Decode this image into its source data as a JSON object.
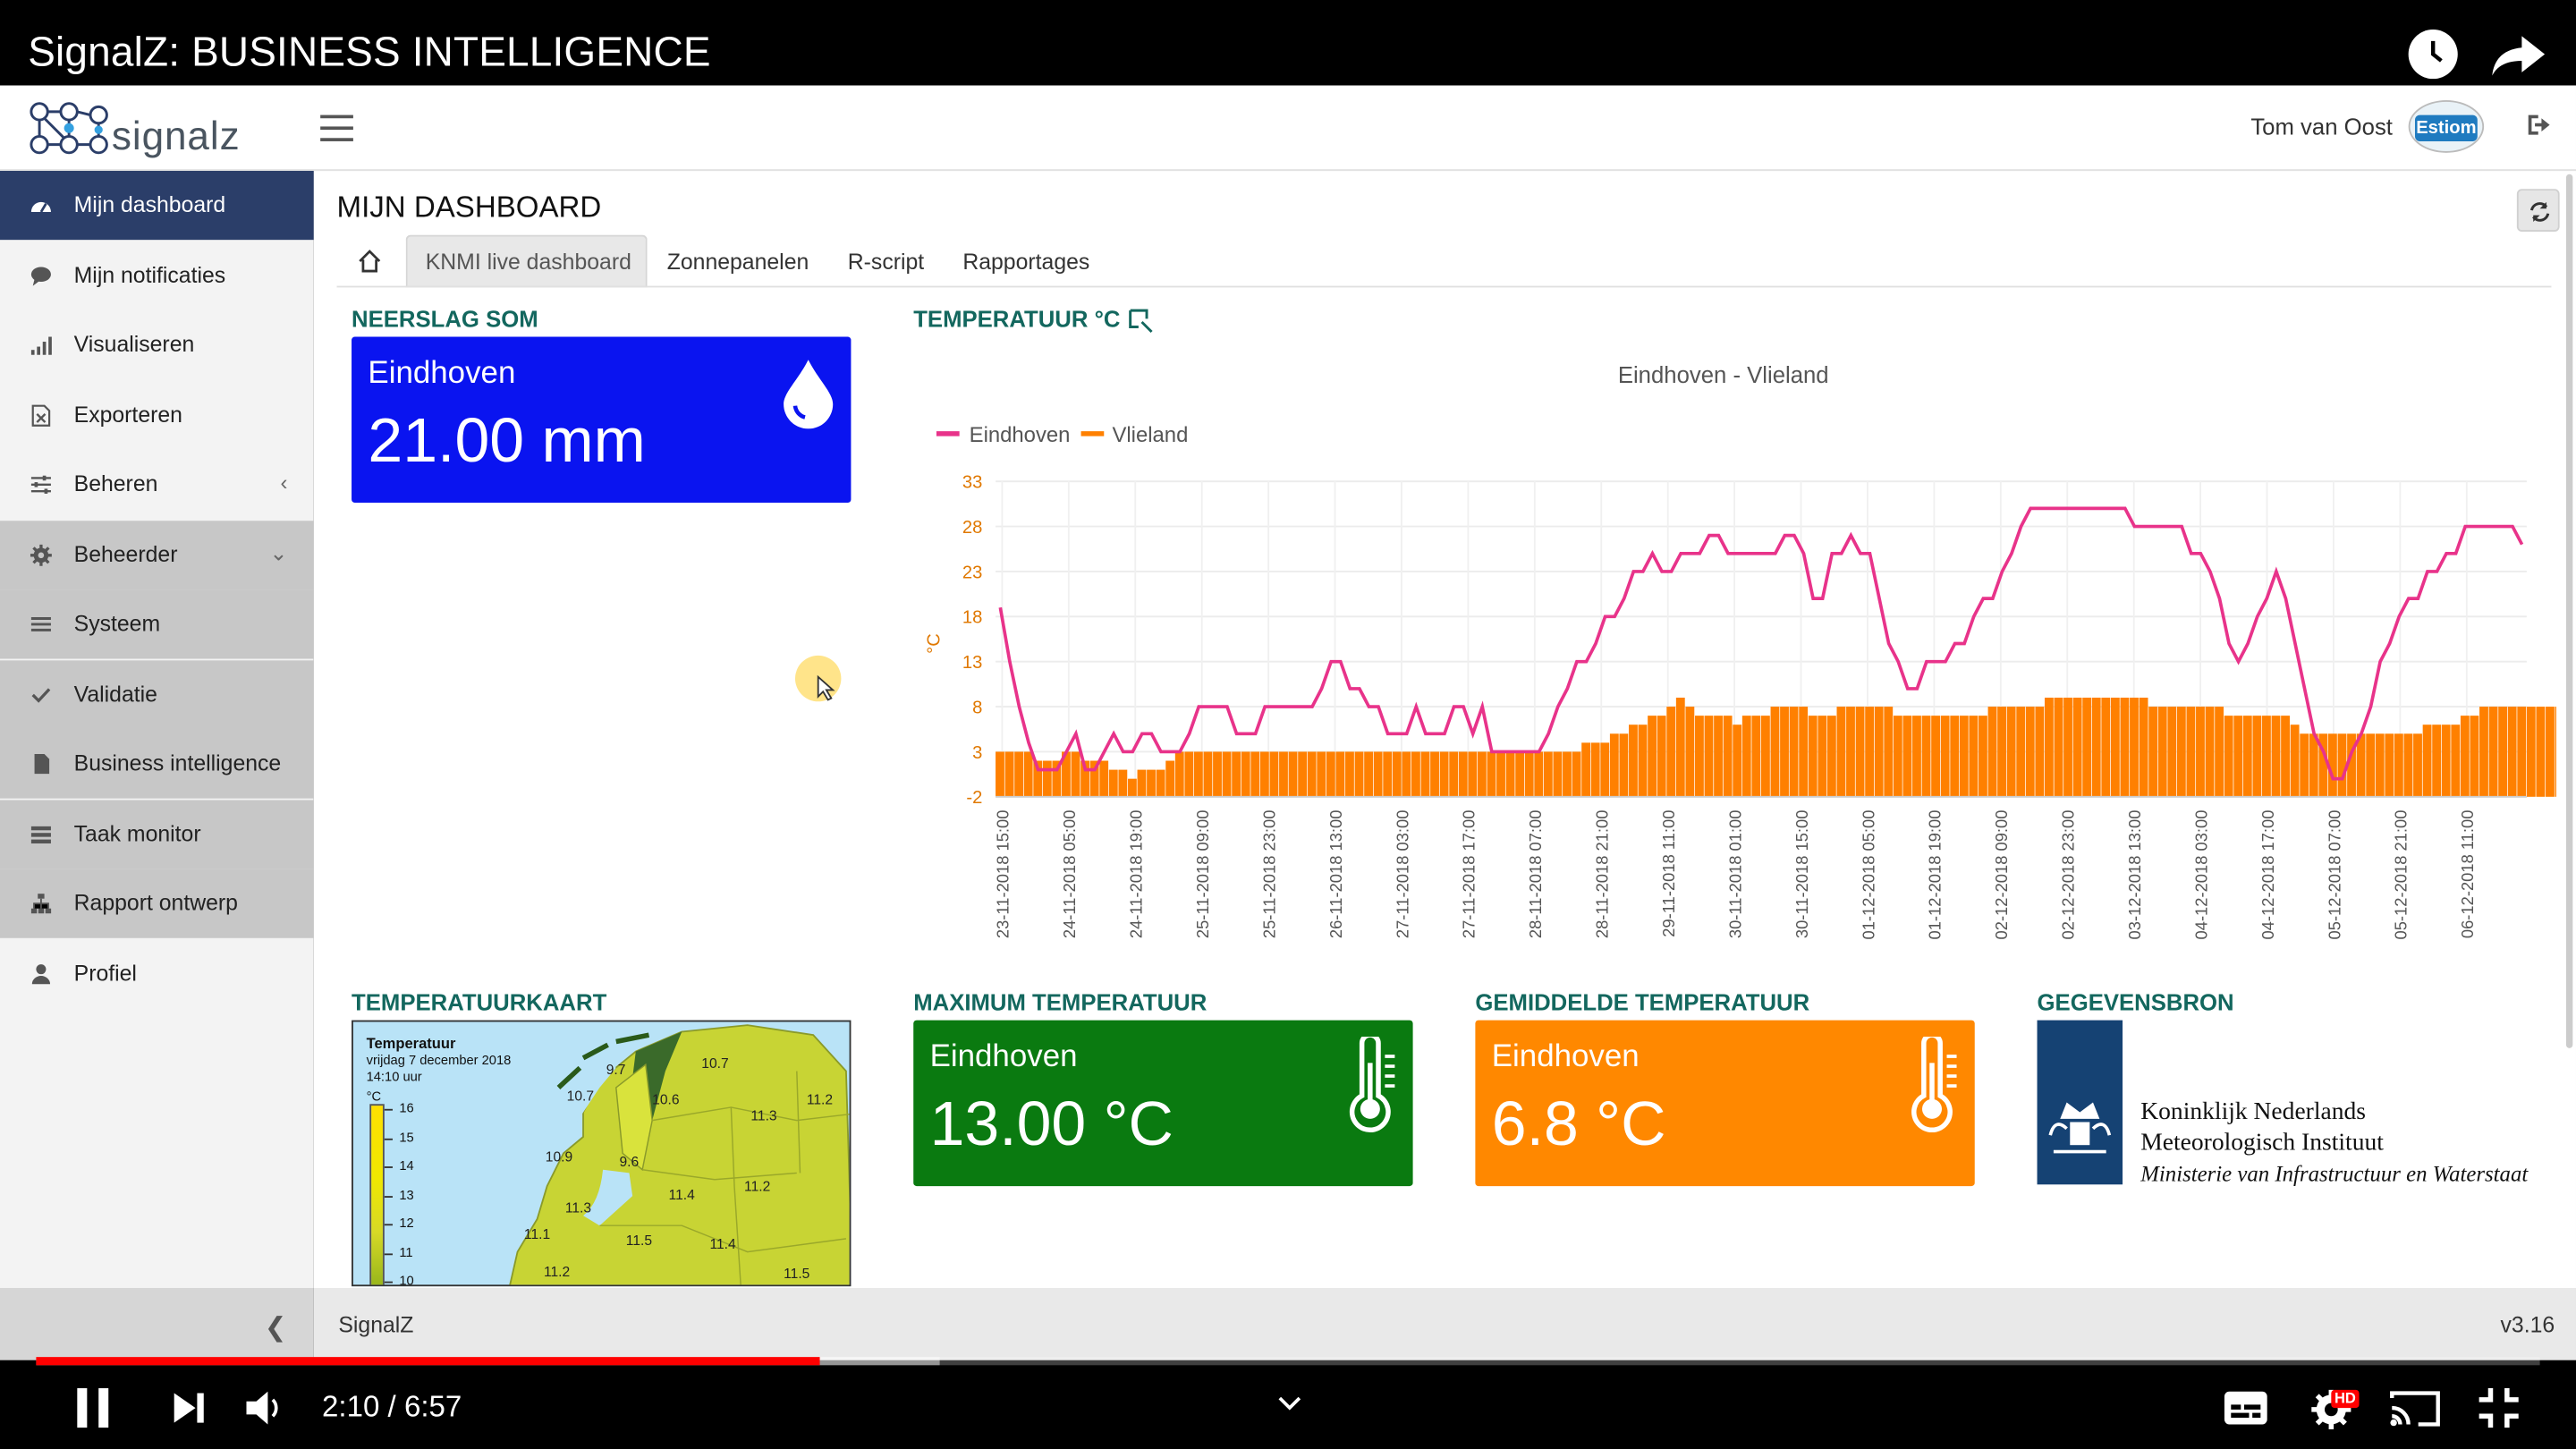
{
  "video": {
    "title": "SignalZ: BUSINESS INTELLIGENCE",
    "time_current": "2:10",
    "time_sep": " / ",
    "time_total": "6:57",
    "progress": 0.3113,
    "hd_badge": "HD"
  },
  "header": {
    "logo_text": "signalz",
    "user_name": "Tom van Oost",
    "org_badge": "Estiom"
  },
  "sidebar": {
    "items": [
      {
        "label": "Mijn dashboard",
        "icon": "dashboard-icon",
        "active": true
      },
      {
        "label": "Mijn notificaties",
        "icon": "comment-icon"
      },
      {
        "label": "Visualiseren",
        "icon": "signal-bars-icon"
      },
      {
        "label": "Exporteren",
        "icon": "file-excel-icon"
      },
      {
        "label": "Beheren",
        "icon": "sliders-icon",
        "arrow": "‹"
      },
      {
        "label": "Beheerder",
        "icon": "gear-icon",
        "arrow": "⌄"
      },
      {
        "label": "Systeem",
        "icon": "list-icon"
      },
      {
        "label": "Validatie",
        "icon": "check-icon"
      },
      {
        "label": "Business intelligence",
        "icon": "file-icon"
      },
      {
        "label": "Taak monitor",
        "icon": "tasks-icon"
      },
      {
        "label": "Rapport ontwerp",
        "icon": "sitemap-icon"
      },
      {
        "label": "Profiel",
        "icon": "user-icon"
      }
    ]
  },
  "main": {
    "page_title": "MIJN DASHBOARD",
    "tabs": [
      {
        "label": "KNMI live dashboard",
        "active": true
      },
      {
        "label": "Zonnepanelen"
      },
      {
        "label": "R-script"
      },
      {
        "label": "Rapportages"
      }
    ],
    "neerslag": {
      "section": "NEERSLAG SOM",
      "city": "Eindhoven",
      "value": "21.00 mm",
      "color": "#0a14f0"
    },
    "temp_chart_section": "TEMPERATUUR °C",
    "tempmap": {
      "section": "TEMPERATUURKAART",
      "title": "Temperatuur",
      "date": "vrijdag 7 december 2018",
      "time": "14:10 uur",
      "unit": "°C",
      "legend": [
        "16",
        "15",
        "14",
        "13",
        "12",
        "11",
        "10"
      ],
      "station_labels": [
        "9.7",
        "10.7",
        "10.7",
        "10.6",
        "11.2",
        "11.3",
        "10.9",
        "9.6",
        "11.4",
        "11.2",
        "11.3",
        "11.1",
        "11.5",
        "11.4",
        "11.2",
        "11.5"
      ]
    },
    "max_temp": {
      "section": "MAXIMUM TEMPERATUUR",
      "city": "Eindhoven",
      "value": "13.00 °C",
      "color": "#0a7a10"
    },
    "avg_temp": {
      "section": "GEMIDDELDE TEMPERATUUR",
      "city": "Eindhoven",
      "value": "6.8 °C",
      "color": "#ff8800"
    },
    "source": {
      "section": "GEGEVENSBRON",
      "line1": "Koninklijk Nederlands",
      "line2": "Meteorologisch Instituut",
      "line3": "Ministerie van Infrastructuur en Waterstaat",
      "brand_color": "#154273"
    }
  },
  "footer": {
    "brand": "SignalZ",
    "version": "v3.16"
  },
  "chart_data": {
    "type": "line",
    "title": "Eindhoven - Vlieland",
    "xlabel": "",
    "ylabel": "°C",
    "ylim": [
      -2,
      33
    ],
    "yticks": [
      -2,
      3,
      8,
      13,
      18,
      23,
      28,
      33
    ],
    "legend_position": "top-left",
    "grid": true,
    "x_tick_labels": [
      "23-11-2018 15:00",
      "24-11-2018 05:00",
      "24-11-2018 19:00",
      "25-11-2018 09:00",
      "25-11-2018 23:00",
      "26-11-2018 13:00",
      "27-11-2018 03:00",
      "27-11-2018 17:00",
      "28-11-2018 07:00",
      "28-11-2018 21:00",
      "29-11-2018 11:00",
      "30-11-2018 01:00",
      "30-11-2018 15:00",
      "01-12-2018 05:00",
      "01-12-2018 19:00",
      "02-12-2018 09:00",
      "02-12-2018 23:00",
      "03-12-2018 13:00",
      "04-12-2018 03:00",
      "04-12-2018 17:00",
      "05-12-2018 07:00",
      "05-12-2018 21:00",
      "06-12-2018 11:00"
    ],
    "series": [
      {
        "name": "Eindhoven",
        "type": "line",
        "color": "#e8338a",
        "values": [
          19,
          13,
          8,
          4,
          1,
          1,
          1,
          3,
          5,
          1,
          1,
          3,
          5,
          3,
          3,
          5,
          5,
          3,
          3,
          3,
          5,
          8,
          8,
          8,
          8,
          5,
          5,
          5,
          8,
          8,
          8,
          8,
          8,
          8,
          10,
          13,
          13,
          10,
          10,
          8,
          8,
          5,
          5,
          5,
          8,
          5,
          5,
          5,
          8,
          8,
          5,
          8,
          3,
          3,
          3,
          3,
          3,
          3,
          5,
          8,
          10,
          13,
          13,
          15,
          18,
          18,
          20,
          23,
          23,
          25,
          23,
          23,
          25,
          25,
          25,
          27,
          27,
          25,
          25,
          25,
          25,
          25,
          25,
          27,
          27,
          25,
          20,
          20,
          25,
          25,
          27,
          25,
          25,
          20,
          15,
          13,
          10,
          10,
          13,
          13,
          13,
          15,
          15,
          18,
          20,
          20,
          23,
          25,
          28,
          30,
          30,
          30,
          30,
          30,
          30,
          30,
          30,
          30,
          30,
          30,
          28,
          28,
          28,
          28,
          28,
          28,
          25,
          25,
          23,
          20,
          15,
          13,
          15,
          18,
          20,
          23,
          20,
          15,
          10,
          5,
          3,
          0,
          0,
          3,
          5,
          8,
          13,
          15,
          18,
          20,
          20,
          23,
          23,
          25,
          25,
          28,
          28,
          28,
          28,
          28,
          28,
          26
        ]
      },
      {
        "name": "Vlieland",
        "type": "bar",
        "color": "#ff8000",
        "values": [
          3,
          3,
          3,
          3,
          2,
          2,
          2,
          3,
          3,
          2,
          2,
          2,
          1,
          1,
          0,
          1,
          1,
          1,
          2,
          3,
          3,
          3,
          3,
          3,
          3,
          3,
          3,
          3,
          3,
          3,
          3,
          3,
          3,
          3,
          3,
          3,
          3,
          3,
          3,
          3,
          3,
          3,
          3,
          3,
          3,
          3,
          3,
          3,
          3,
          3,
          3,
          3,
          3,
          3,
          3,
          3,
          3,
          3,
          3,
          3,
          3,
          3,
          4,
          4,
          4,
          5,
          5,
          6,
          6,
          7,
          7,
          8,
          9,
          8,
          7,
          7,
          7,
          7,
          6,
          7,
          7,
          7,
          8,
          8,
          8,
          8,
          7,
          7,
          7,
          8,
          8,
          8,
          8,
          8,
          8,
          7,
          7,
          7,
          7,
          7,
          7,
          7,
          7,
          7,
          7,
          8,
          8,
          8,
          8,
          8,
          8,
          9,
          9,
          9,
          9,
          9,
          9,
          9,
          9,
          9,
          9,
          9,
          8,
          8,
          8,
          8,
          8,
          8,
          8,
          8,
          7,
          7,
          7,
          7,
          7,
          7,
          7,
          6,
          5,
          5,
          5,
          5,
          5,
          5,
          5,
          5,
          5,
          5,
          5,
          5,
          5,
          6,
          6,
          6,
          6,
          7,
          7,
          8,
          8,
          8,
          8,
          8,
          8,
          8,
          8,
          8,
          8
        ]
      }
    ]
  }
}
